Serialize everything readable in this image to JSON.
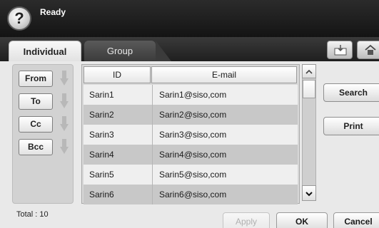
{
  "header": {
    "status": "Ready",
    "help_glyph": "?"
  },
  "tabs": [
    {
      "label": "Individual",
      "active": true
    },
    {
      "label": "Group",
      "active": false
    }
  ],
  "header_icons": [
    "import-icon",
    "home-icon"
  ],
  "fields": [
    {
      "label": "From"
    },
    {
      "label": "To"
    },
    {
      "label": "Cc"
    },
    {
      "label": "Bcc"
    }
  ],
  "table": {
    "columns": [
      "ID",
      "E-mail"
    ],
    "rows": [
      {
        "id": "Sarin1",
        "email": "Sarin1@siso,com"
      },
      {
        "id": "Sarin2",
        "email": "Sarin2@siso,com"
      },
      {
        "id": "Sarin3",
        "email": "Sarin3@siso,com"
      },
      {
        "id": "Sarin4",
        "email": "Sarin4@siso,com"
      },
      {
        "id": "Sarin5",
        "email": "Sarin5@siso,com"
      },
      {
        "id": "Sarin6",
        "email": "Sarin6@siso,com"
      }
    ]
  },
  "side_buttons": {
    "search": "Search",
    "print": "Print"
  },
  "footer": {
    "total": "Total : 10",
    "apply": "Apply",
    "ok": "OK",
    "cancel": "Cancel"
  },
  "colors": {
    "title_bar": "#1f1f1f",
    "body": "#e9e9e9",
    "row_alt": "#c8c8c8"
  }
}
